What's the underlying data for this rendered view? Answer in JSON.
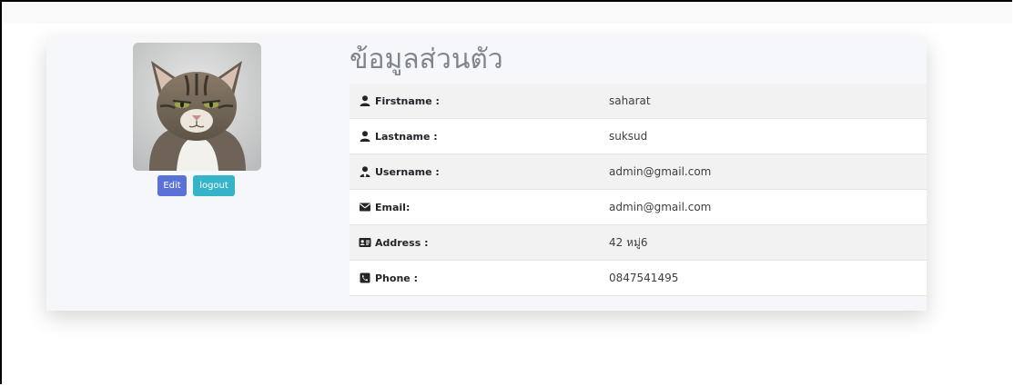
{
  "profile": {
    "title": "ข้อมูลส่วนตัว",
    "avatar_icon": "cat-photo",
    "edit_label": "Edit",
    "logout_label": "logout"
  },
  "fields": [
    {
      "label": "Firstname :",
      "value": "saharat",
      "icon": "user-icon"
    },
    {
      "label": "Lastname :",
      "value": "suksud",
      "icon": "user-icon"
    },
    {
      "label": "Username :",
      "value": "admin@gmail.com",
      "icon": "user-tie-icon"
    },
    {
      "label": "Email:",
      "value": "admin@gmail.com",
      "icon": "envelope-icon"
    },
    {
      "label": "Address :",
      "value": "42 หมู่6",
      "icon": "address-card-icon"
    },
    {
      "label": "Phone :",
      "value": "0847541495",
      "icon": "phone-square-icon"
    }
  ],
  "colors": {
    "edit_button": "#5a72d8",
    "logout_button": "#35b4c9",
    "title": "#7f858c"
  }
}
